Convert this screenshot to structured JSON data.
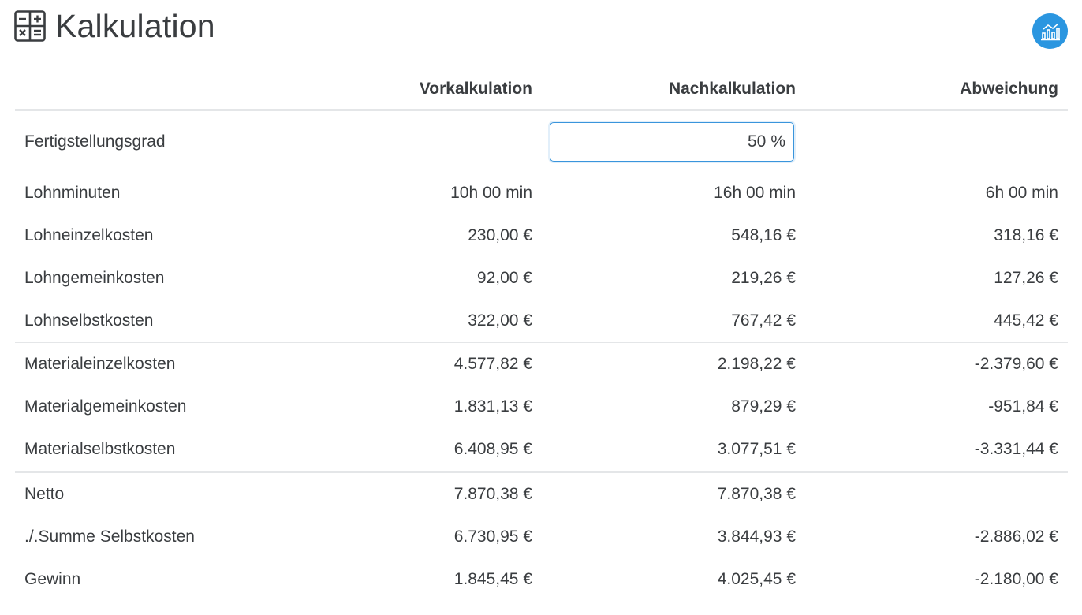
{
  "header": {
    "title": "Kalkulation",
    "icon": "calculator-icon",
    "action_icon": "chart-analytics-icon"
  },
  "colors": {
    "accent": "#2b96e0",
    "text": "#3a3d40",
    "divider": "#e4e6e8"
  },
  "table": {
    "columns": [
      "",
      "Vorkalkulation",
      "Nachkalkulation",
      "Abweichung"
    ],
    "completion": {
      "label": "Fertigstellungsgrad",
      "value": "50",
      "unit": "%"
    },
    "rows": [
      {
        "label": "Lohnminuten",
        "vor": "10h 00 min",
        "nach": "16h 00 min",
        "abw": "6h 00 min"
      },
      {
        "label": "Lohneinzelkosten",
        "vor": "230,00 €",
        "nach": "548,16 €",
        "abw": "318,16 €"
      },
      {
        "label": "Lohngemeinkosten",
        "vor": "92,00 €",
        "nach": "219,26 €",
        "abw": "127,26 €"
      },
      {
        "label": "Lohnselbstkosten",
        "vor": "322,00 €",
        "nach": "767,42 €",
        "abw": "445,42 €"
      },
      {
        "label": "Materialeinzelkosten",
        "vor": "4.577,82 €",
        "nach": "2.198,22 €",
        "abw": "-2.379,60 €"
      },
      {
        "label": "Materialgemeinkosten",
        "vor": "1.831,13 €",
        "nach": "879,29 €",
        "abw": "-951,84 €"
      },
      {
        "label": "Materialselbstkosten",
        "vor": "6.408,95 €",
        "nach": "3.077,51 €",
        "abw": "-3.331,44 €"
      },
      {
        "label": "Netto",
        "vor": "7.870,38 €",
        "nach": "7.870,38 €",
        "abw": ""
      },
      {
        "label": "./.Summe Selbstkosten",
        "vor": "6.730,95 €",
        "nach": "3.844,93 €",
        "abw": "-2.886,02 €"
      },
      {
        "label": "Gewinn",
        "vor": "1.845,45 €",
        "nach": "4.025,45 €",
        "abw": "-2.180,00 €"
      }
    ]
  }
}
